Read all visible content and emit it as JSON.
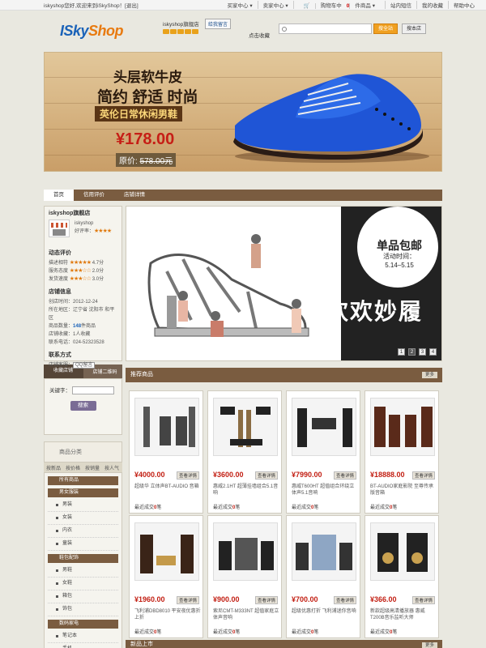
{
  "topbar": {
    "welcome": "iskyshop您好,欢迎来到iSkyShop！[退出]",
    "links": [
      "买家中心 ▾",
      "卖家中心 ▾",
      "站内短信",
      "我的收藏",
      "帮助中心"
    ],
    "cart_prefix": "购物车中",
    "cart_count": "0",
    "cart_suffix": "件商品 ▾"
  },
  "header": {
    "logo_i": "ISky",
    "logo_shop": "Shop",
    "store_name": "iskyshop旗舰店",
    "message_button": "给我留言",
    "fav_link": "点击收藏",
    "search_placeholder": "",
    "site_search_button": "搜全站",
    "shop_search_button": "搜本店"
  },
  "banner": {
    "line1": "头层软牛皮",
    "line2": "简约 舒适 时尚",
    "line3": "英伦日常休闲男鞋",
    "price": "¥178.00",
    "orig_label": "原价:",
    "orig_price": "578.00元"
  },
  "nav": {
    "tabs": [
      "首页",
      "信用评价",
      "店铺详情"
    ]
  },
  "shop": {
    "title": "iskyshop旗舰店",
    "name": "iskyshop",
    "rate": "好评率：",
    "dynamic_title": "动态评价",
    "ratings": [
      {
        "label": "描述相符",
        "stars": "★★★★★",
        "score": "4.7分"
      },
      {
        "label": "服务态度",
        "stars": "★★★☆☆",
        "score": "2.0分"
      },
      {
        "label": "发货速度",
        "stars": "★★★☆☆",
        "score": "3.0分"
      }
    ],
    "info_title": "店铺信息",
    "created": "创店时间：2012-12-24",
    "location": "所在地区：辽宁省 沈阳市 和平区",
    "goods_count_label": "商品数量：",
    "goods_count": "148",
    "goods_count_unit": "件商品",
    "fav_count": "店铺收藏：1人收藏",
    "phone": "联系电话：024-52323528",
    "contact_title": "联系方式",
    "contact_label": "店铺客服：",
    "qq": "QQ留言"
  },
  "lefttabs": {
    "fav": "收藏店铺",
    "qrcode": "店铺二维码"
  },
  "searchpanel": {
    "label": "关键字：",
    "button": "搜索"
  },
  "category": {
    "title": "商品分类",
    "sorts": [
      "按新品",
      "按价格",
      "按销量",
      "按人气"
    ],
    "groups": [
      {
        "name": "所有商品",
        "subs": []
      },
      {
        "name": "男女服装",
        "subs": [
          "男装",
          "女装",
          "内衣",
          "童装"
        ]
      },
      {
        "name": "鞋包配饰",
        "subs": [
          "男鞋",
          "女鞋",
          "箱包",
          "饰包"
        ]
      },
      {
        "name": "数码家电",
        "subs": [
          "笔记本",
          "手机"
        ]
      }
    ]
  },
  "slide": {
    "promo": "单品包邮",
    "promo_sub1": "活动时间：",
    "promo_sub2": "5.14–5.15",
    "big": "欢欢妙履",
    "pages": [
      "1",
      "2",
      "3",
      "4"
    ],
    "active_page": 2
  },
  "rec": {
    "title": "推荐商品",
    "more": "更多"
  },
  "products": [
    {
      "price": "¥4000.00",
      "look": "查看详情",
      "name": "超级华 立体声BT-AUDIO 音箱",
      "sold_prefix": "最近成交",
      "sold": "0",
      "sold_suffix": "笔"
    },
    {
      "price": "¥3600.00",
      "look": "查看详情",
      "name": "惠威2.1HT 超薄挂墙组合5.1音响",
      "sold_prefix": "最近成交",
      "sold": "0",
      "sold_suffix": "笔"
    },
    {
      "price": "¥7990.00",
      "look": "查看详情",
      "name": "惠威T600HT 超值组合环绕立体声5.1音响",
      "sold_prefix": "最近成交",
      "sold": "0",
      "sold_suffix": "笔"
    },
    {
      "price": "¥18888.00",
      "look": "查看详情",
      "name": "BT-AUDIO家庭影院 至尊传承版音箱",
      "sold_prefix": "最近成交",
      "sold": "0",
      "sold_suffix": "笔"
    },
    {
      "price": "¥1960.00",
      "look": "查看详情",
      "name": "飞利浦DBD8010 平安夜优惠折上折",
      "sold_prefix": "最近成交",
      "sold": "0",
      "sold_suffix": "笔"
    },
    {
      "price": "¥900.00",
      "look": "查看详情",
      "name": "索尼CMT-M333NT 超值家庭立体声音响",
      "sold_prefix": "最近成交",
      "sold": "0",
      "sold_suffix": "笔"
    },
    {
      "price": "¥700.00",
      "look": "查看详情",
      "name": "超级优惠打折 飞利浦迷你音响",
      "sold_prefix": "最近成交",
      "sold": "0",
      "sold_suffix": "笔"
    },
    {
      "price": "¥366.00",
      "look": "查看详情",
      "name": "新款超级高清播放器 惠威T200B音乐监听大师",
      "sold_prefix": "最近成交",
      "sold": "0",
      "sold_suffix": "笔"
    }
  ],
  "newbar": {
    "title": "新品上市",
    "more": "更多"
  },
  "colors": {
    "nav_brown": "#7a5c40",
    "price_red": "#c21e12",
    "logo_blue": "#1a62b8",
    "logo_orange": "#e87a10"
  }
}
